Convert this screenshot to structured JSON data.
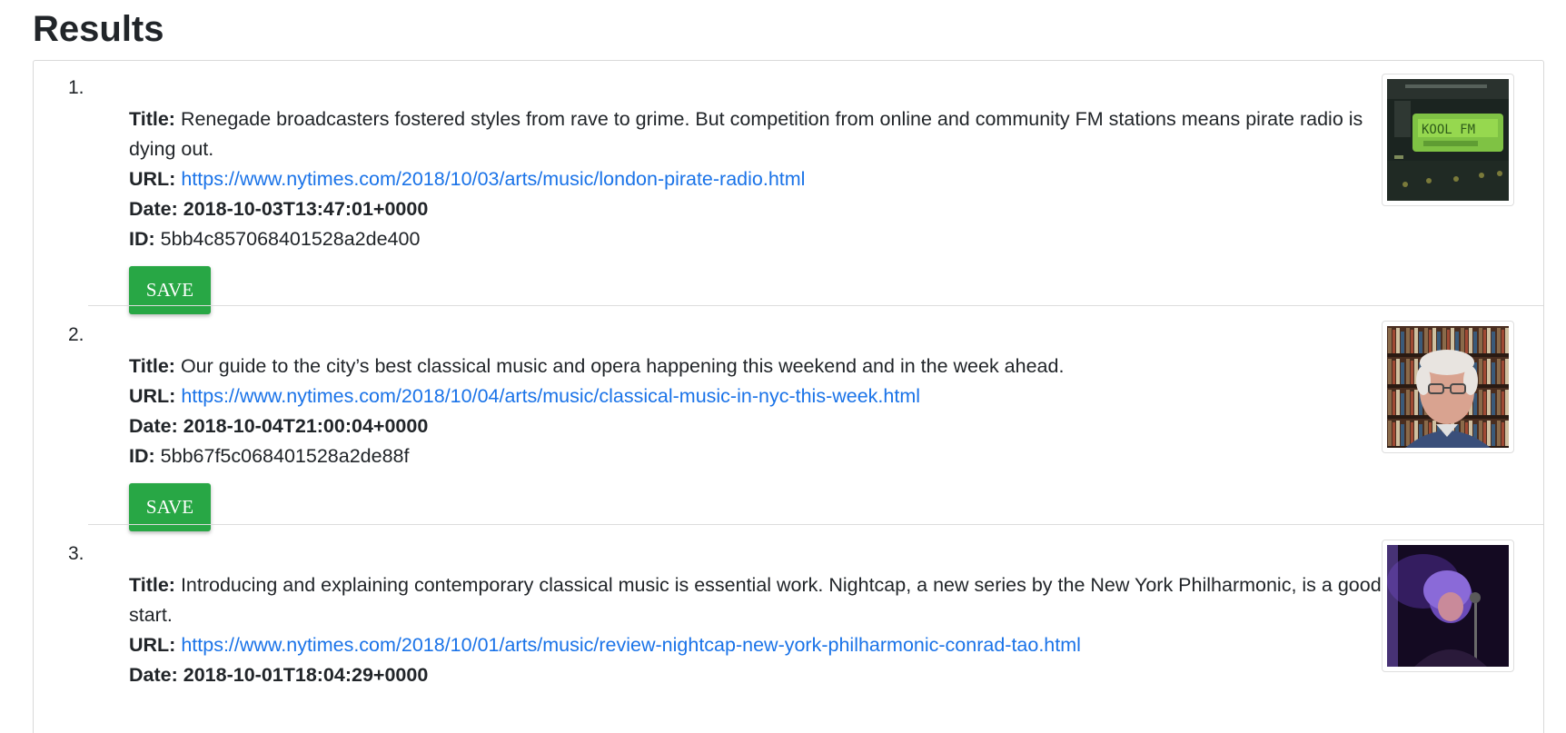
{
  "page": {
    "title": "Results"
  },
  "labels": {
    "title": "Title:",
    "url": "URL:",
    "date": "Date:",
    "id": "ID:",
    "save": "SAVE"
  },
  "results": [
    {
      "number": "1.",
      "title": "Renegade broadcasters fostered styles from rave to grime. But competition from online and community FM stations means pirate radio is dying out.",
      "url": "https://www.nytimes.com/2018/10/03/arts/music/london-pirate-radio.html",
      "date": "2018-10-03T13:47:01+0000",
      "id": "5bb4c857068401528a2de400",
      "thumbnail_icon": "radio-display-image"
    },
    {
      "number": "2.",
      "title": "Our guide to the city’s best classical music and opera happening this weekend and in the week ahead.",
      "url": "https://www.nytimes.com/2018/10/04/arts/music/classical-music-in-nyc-this-week.html",
      "date": "2018-10-04T21:00:04+0000",
      "id": "5bb67f5c068401528a2de88f",
      "thumbnail_icon": "portrait-image"
    },
    {
      "number": "3.",
      "title": "Introducing and explaining contemporary classical music is essential work. Nightcap, a new series by the New York Philharmonic, is a good start.",
      "url": "https://www.nytimes.com/2018/10/01/arts/music/review-nightcap-new-york-philharmonic-conrad-tao.html",
      "date": "2018-10-01T18:04:29+0000",
      "thumbnail_icon": "performer-image"
    }
  ],
  "colors": {
    "link": "#1a73e8",
    "save_button": "#28a745",
    "text": "#212529",
    "border": "#d9d9d9"
  }
}
